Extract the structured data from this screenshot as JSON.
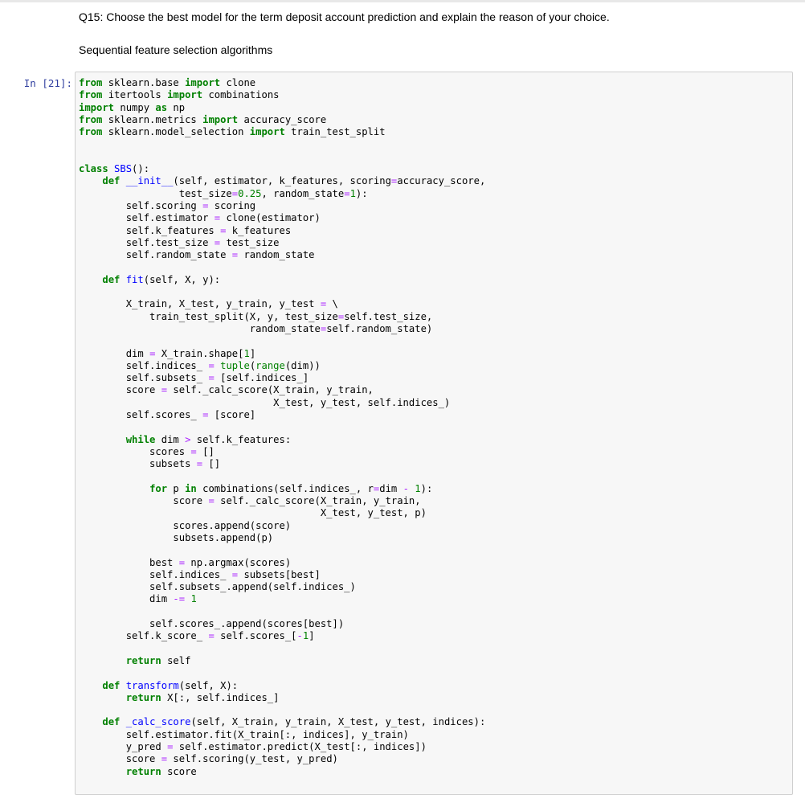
{
  "markdown": {
    "question": "Q15: Choose the best model for the term deposit account prediction and explain the reason of your choice.",
    "heading": "Sequential feature selection algorithms"
  },
  "cell": {
    "prompt": "In [21]:",
    "code": "from sklearn.base import clone\nfrom itertools import combinations\nimport numpy as np\nfrom sklearn.metrics import accuracy_score\nfrom sklearn.model_selection import train_test_split\n\n\nclass SBS():\n    def __init__(self, estimator, k_features, scoring=accuracy_score,\n                 test_size=0.25, random_state=1):\n        self.scoring = scoring\n        self.estimator = clone(estimator)\n        self.k_features = k_features\n        self.test_size = test_size\n        self.random_state = random_state\n\n    def fit(self, X, y):\n\n        X_train, X_test, y_train, y_test = \\\n            train_test_split(X, y, test_size=self.test_size,\n                             random_state=self.random_state)\n\n        dim = X_train.shape[1]\n        self.indices_ = tuple(range(dim))\n        self.subsets_ = [self.indices_]\n        score = self._calc_score(X_train, y_train,\n                                 X_test, y_test, self.indices_)\n        self.scores_ = [score]\n\n        while dim > self.k_features:\n            scores = []\n            subsets = []\n\n            for p in combinations(self.indices_, r=dim - 1):\n                score = self._calc_score(X_train, y_train,\n                                         X_test, y_test, p)\n                scores.append(score)\n                subsets.append(p)\n\n            best = np.argmax(scores)\n            self.indices_ = subsets[best]\n            self.subsets_.append(self.indices_)\n            dim -= 1\n\n            self.scores_.append(scores[best])\n        self.k_score_ = self.scores_[-1]\n\n        return self\n\n    def transform(self, X):\n        return X[:, self.indices_]\n\n    def _calc_score(self, X_train, y_train, X_test, y_test, indices):\n        self.estimator.fit(X_train[:, indices], y_train)\n        y_pred = self.estimator.predict(X_test[:, indices])\n        score = self.scoring(y_test, y_pred)\n        return score"
  }
}
